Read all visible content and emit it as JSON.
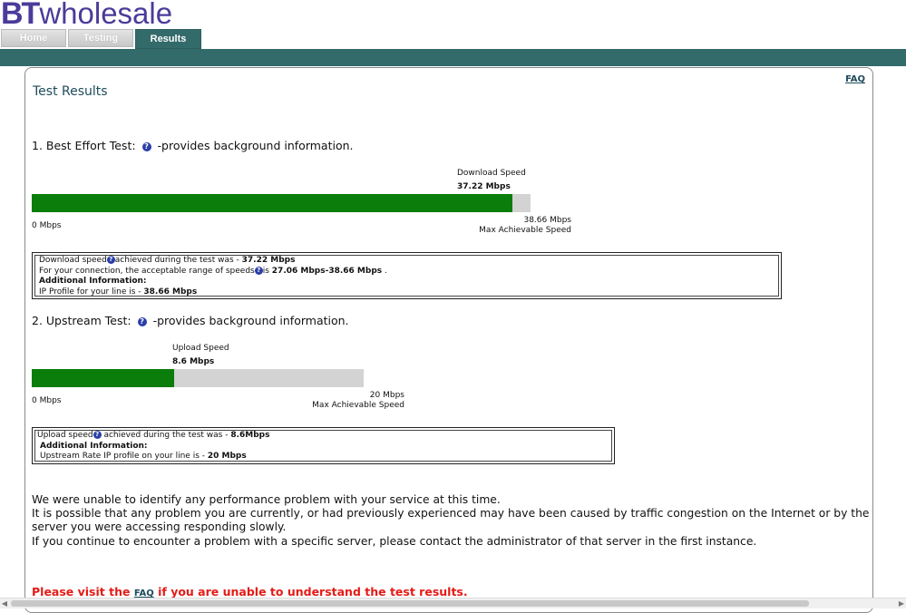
{
  "header": {
    "logo_bt": "BT",
    "logo_text": "wholesale",
    "tabs": [
      {
        "label": "Home"
      },
      {
        "label": "Testing"
      },
      {
        "label": "Results"
      }
    ]
  },
  "colors": {
    "brand": "#4b3b9a",
    "teal": "#336a6a",
    "bar_fill": "#0a7d0a",
    "bar_track": "#d3d3d3",
    "warning": "#e41b17"
  },
  "page": {
    "title": "Test Results",
    "faq_link": "FAQ"
  },
  "best_effort": {
    "heading": "1. Best Effort Test:",
    "heading_suffix": "-provides background information.",
    "help_icon": "question-circle-icon",
    "speed_label": "Download Speed",
    "speed_value": "37.22 Mbps",
    "min_label": "0 Mbps",
    "max_value": "38.66 Mbps",
    "max_label": "Max Achievable Speed",
    "fill_fraction": 0.963,
    "info": {
      "line1_pre": "Download speed",
      "line1_mid": "achieved during the test was - ",
      "line1_val": "37.22 Mbps",
      "line2_pre": "For your connection, the acceptable range of speeds",
      "line2_mid": "is ",
      "line2_val": "27.06 Mbps-38.66 Mbps",
      "line2_end": " .",
      "line3": "Additional Information:",
      "line4_pre": "IP Profile for your line is - ",
      "line4_val": "38.66 Mbps"
    }
  },
  "upstream": {
    "heading": "2. Upstream Test:",
    "heading_suffix": "-provides background information.",
    "help_icon": "question-circle-icon",
    "speed_label": "Upload Speed",
    "speed_value": "8.6 Mbps",
    "min_label": "0 Mbps",
    "max_value": "20 Mbps",
    "max_label": "Max Achievable Speed",
    "fill_fraction": 0.43,
    "info": {
      "line1_pre": "Upload speed",
      "line1_mid": " achieved during the test was - ",
      "line1_val": "8.6Mbps",
      "line2": "Additional Information:",
      "line3_pre": "Upstream Rate IP profile on your line is - ",
      "line3_val": "20 Mbps"
    }
  },
  "summary": {
    "p1": "We were unable to identify any performance problem with your service at this time.",
    "p2": "It is possible that any problem you are currently, or had previously experienced may have been caused by traffic congestion on the Internet or by the server you were accessing responding slowly.",
    "p3": "If you continue to encounter a problem with a specific server, please contact the administrator of that server in the first instance."
  },
  "warning": {
    "pre": "Please visit the ",
    "link": "FAQ",
    "post": " if you are unable to understand the test results."
  }
}
